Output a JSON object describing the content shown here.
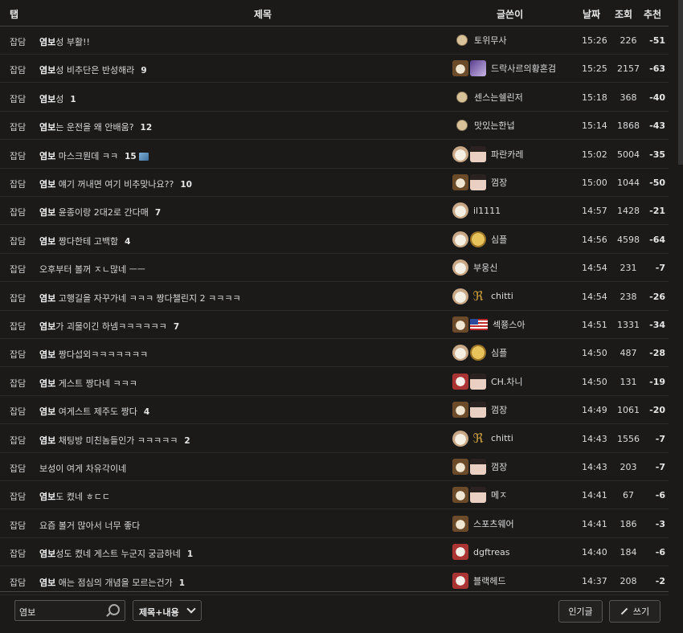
{
  "header": {
    "tab": "탭",
    "title": "제목",
    "author": "글쓴이",
    "date": "날짜",
    "views": "조회",
    "rec": "추천"
  },
  "rows": [
    {
      "tab": "잡담",
      "bold": "염보",
      "title": "성 부활!!",
      "cmt": "",
      "author": "토위무사",
      "icons": [
        "mon"
      ],
      "time": "15:26",
      "views": "226",
      "rec": "-51"
    },
    {
      "tab": "잡담",
      "bold": "염보",
      "title": "성 비추단은 반성해라",
      "cmt": "9",
      "author": "드락사르의황혼검",
      "icons": [
        "dog",
        "purple"
      ],
      "time": "15:25",
      "views": "2157",
      "rec": "-63"
    },
    {
      "tab": "잡담",
      "bold": "염보",
      "title": "성",
      "cmt": "1",
      "author": "센스는쉘린저",
      "icons": [
        "mon"
      ],
      "time": "15:18",
      "views": "368",
      "rec": "-40"
    },
    {
      "tab": "잡담",
      "bold": "염보",
      "title": "는 운전을 왜 안배움?",
      "cmt": "12",
      "author": "맛있는한넙",
      "icons": [
        "mon"
      ],
      "time": "15:14",
      "views": "1868",
      "rec": "-43"
    },
    {
      "tab": "잡담",
      "bold": "염보",
      "title": " 마스크뭔데 ㅋㅋ",
      "cmt": "15",
      "author": "파란카레",
      "icons": [
        "dog2",
        "face"
      ],
      "time": "15:02",
      "views": "5004",
      "rec": "-35",
      "img": true
    },
    {
      "tab": "잡담",
      "bold": "염보",
      "title": " 얘기 꺼내면 여기 비추맞나요??",
      "cmt": "10",
      "author": "껌장",
      "icons": [
        "dog",
        "face"
      ],
      "time": "15:00",
      "views": "1044",
      "rec": "-50"
    },
    {
      "tab": "잡담",
      "bold": "염보",
      "title": " 윤종이랑 2대2로 간다매",
      "cmt": "7",
      "author": "il1111",
      "icons": [
        "dog2"
      ],
      "time": "14:57",
      "views": "1428",
      "rec": "-21"
    },
    {
      "tab": "잡담",
      "bold": "염보",
      "title": " 짱다한테 고백함",
      "cmt": "4",
      "author": "심플",
      "icons": [
        "dog2",
        "gold"
      ],
      "time": "14:56",
      "views": "4598",
      "rec": "-64"
    },
    {
      "tab": "잡담",
      "bold": "",
      "title": "오후부터 볼꺼 ㅈㄴ많네 ㅡㅡ",
      "cmt": "",
      "author": "부웅신",
      "icons": [
        "dog2"
      ],
      "time": "14:54",
      "views": "231",
      "rec": "-7"
    },
    {
      "tab": "잡담",
      "bold": "염보",
      "title": " 고행길을 자꾸가네 ㅋㅋㅋ 짱다챌린지 2 ㅋㅋㅋㅋ",
      "cmt": "",
      "author": "chitti",
      "icons": [
        "dog2",
        "rf"
      ],
      "time": "14:54",
      "views": "238",
      "rec": "-26"
    },
    {
      "tab": "잡담",
      "bold": "염보",
      "title": "가 괴물이긴 하넴ㅋㅋㅋㅋㅋㅋ",
      "cmt": "7",
      "author": "섹쭁스아",
      "icons": [
        "dog",
        "flag"
      ],
      "time": "14:51",
      "views": "1331",
      "rec": "-34"
    },
    {
      "tab": "잡담",
      "bold": "염보",
      "title": " 짱다섭외ㅋㅋㅋㅋㅋㅋㅋ",
      "cmt": "",
      "author": "심플",
      "icons": [
        "dog2",
        "gold"
      ],
      "time": "14:50",
      "views": "487",
      "rec": "-28"
    },
    {
      "tab": "잡담",
      "bold": "염보",
      "title": " 게스트 짱다네 ㅋㅋㅋ",
      "cmt": "",
      "author": "CH.차니",
      "icons": [
        "red",
        "face"
      ],
      "time": "14:50",
      "views": "131",
      "rec": "-19"
    },
    {
      "tab": "잡담",
      "bold": "염보",
      "title": " 여게스트 제주도 짱다",
      "cmt": "4",
      "author": "껌장",
      "icons": [
        "dog",
        "face"
      ],
      "time": "14:49",
      "views": "1061",
      "rec": "-20"
    },
    {
      "tab": "잡담",
      "bold": "염보",
      "title": " 채팅방 미친놈들인가 ㅋㅋㅋㅋㅋ",
      "cmt": "2",
      "author": "chitti",
      "icons": [
        "dog2",
        "rf"
      ],
      "time": "14:43",
      "views": "1556",
      "rec": "-7"
    },
    {
      "tab": "잡담",
      "bold": "",
      "title": "보성이 여게 차유각이네",
      "cmt": "",
      "author": "껌장",
      "icons": [
        "dog",
        "face"
      ],
      "time": "14:43",
      "views": "203",
      "rec": "-7"
    },
    {
      "tab": "잡담",
      "bold": "염보",
      "title": "도 켰네 ㅎㄷㄷ",
      "cmt": "",
      "author": "메ㅈ",
      "icons": [
        "dog",
        "face"
      ],
      "time": "14:41",
      "views": "67",
      "rec": "-6"
    },
    {
      "tab": "잡담",
      "bold": "",
      "title": "요즘 볼거 많아서 너무 좋다",
      "cmt": "",
      "author": "스포츠웨어",
      "icons": [
        "dog"
      ],
      "time": "14:41",
      "views": "186",
      "rec": "-3"
    },
    {
      "tab": "잡담",
      "bold": "염보",
      "title": "성도 켰네 게스트 누군지 궁금하네",
      "cmt": "1",
      "author": "dgftreas",
      "icons": [
        "red"
      ],
      "time": "14:40",
      "views": "184",
      "rec": "-6"
    },
    {
      "tab": "잡담",
      "bold": "염보",
      "title": " 애는 점심의 개념을 모르는건가",
      "cmt": "1",
      "author": "블랙헤드",
      "icons": [
        "red"
      ],
      "time": "14:37",
      "views": "208",
      "rec": "-2"
    }
  ],
  "footer": {
    "search_value": "염보",
    "select_value": "제목+내용",
    "popular_label": "인기글",
    "write_label": "쓰기"
  }
}
